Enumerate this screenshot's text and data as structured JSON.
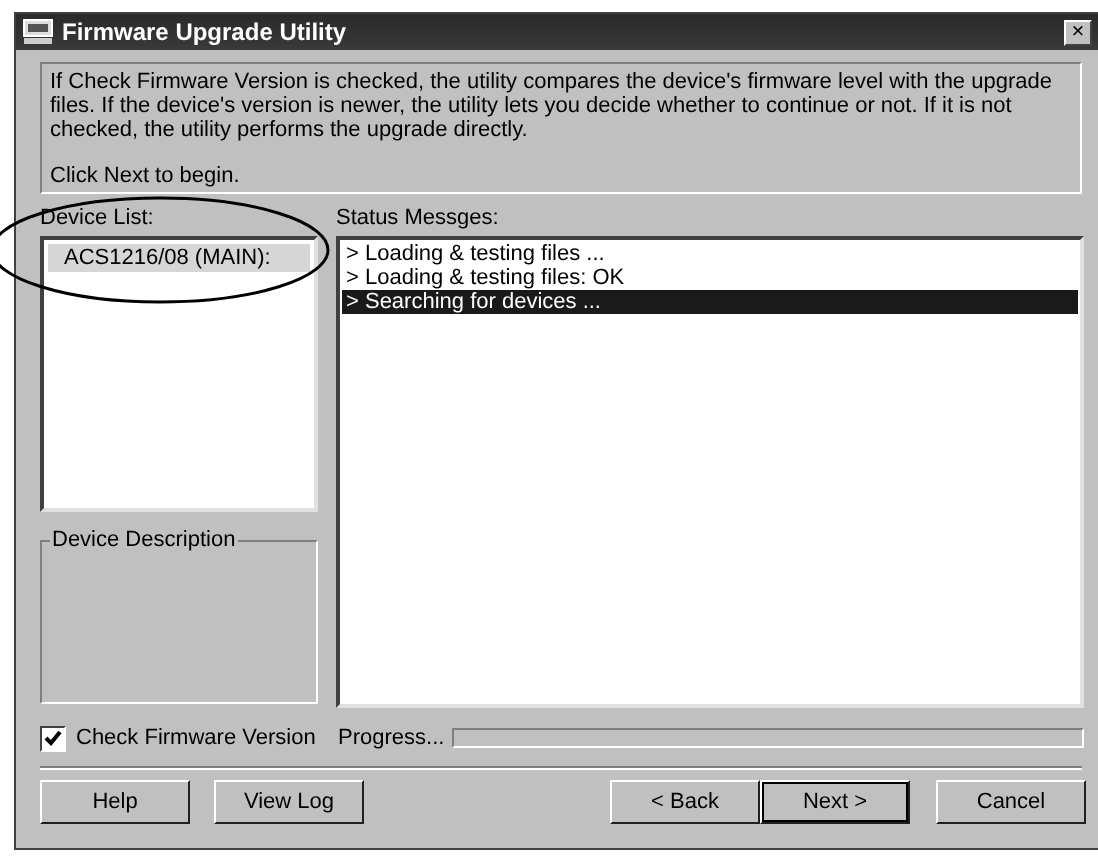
{
  "window": {
    "title": "Firmware Upgrade Utility",
    "close": "×"
  },
  "instructions": {
    "lines": [
      "If Check Firmware Version is checked, the utility compares the device's firmware level with the upgrade files. If the device's version is newer, the utility lets you decide whether to continue or not. If it is not checked, the utility performs the upgrade directly.",
      "Click Next to begin."
    ]
  },
  "device_list": {
    "label": "Device List:",
    "items": [
      {
        "text": "ACS1216/08 (MAIN):",
        "selected": true
      }
    ]
  },
  "status": {
    "label": "Status Messges:",
    "messages": [
      {
        "text": "> Loading & testing files ...",
        "selected": false
      },
      {
        "text": "> Loading & testing files: OK",
        "selected": false
      },
      {
        "text": "> Searching for devices ...",
        "selected": true
      }
    ]
  },
  "device_description": {
    "label": "Device Description"
  },
  "check_firmware": {
    "label": "Check Firmware Version",
    "checked": true
  },
  "progress": {
    "label": "Progress...",
    "level": 0
  },
  "buttons": [
    {
      "label": "Help",
      "default": false
    },
    {
      "label": "View Log",
      "default": false
    },
    {
      "label": "< Back",
      "default": false
    },
    {
      "label": "Next >",
      "default": true
    },
    {
      "label": "Cancel",
      "default": false
    }
  ]
}
